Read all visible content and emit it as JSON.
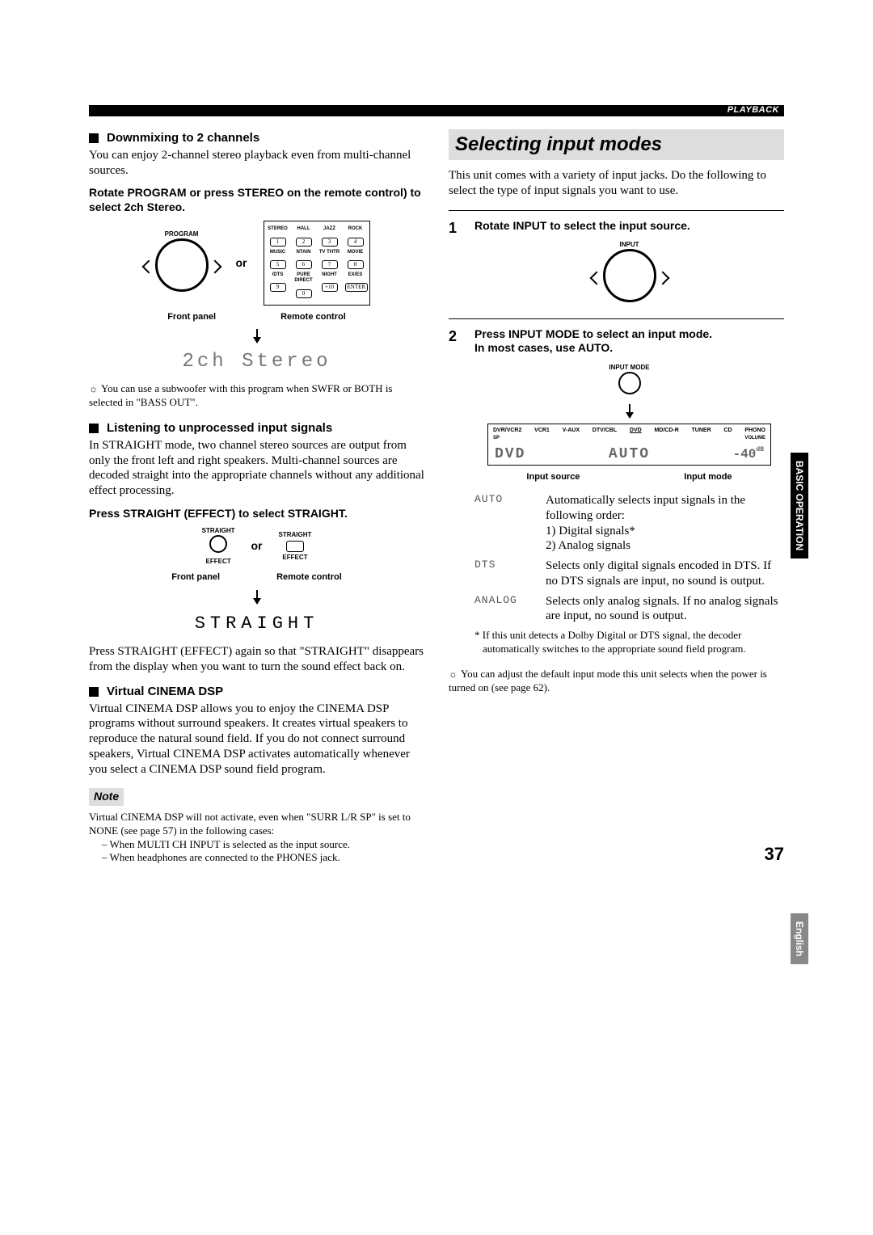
{
  "header": {
    "section": "PLAYBACK"
  },
  "left": {
    "h1": "Downmixing to 2 channels",
    "p1": "You can enjoy 2-channel stereo playback even from multi-channel sources.",
    "b1": "Rotate PROGRAM or press STEREO on the remote control) to select 2ch Stereo.",
    "diagram1": {
      "program": "PROGRAM",
      "or": "or",
      "front": "Front panel",
      "remote": "Remote control",
      "btns": [
        [
          "STEREO",
          "HALL",
          "JAZZ",
          "ROCK"
        ],
        [
          "1",
          "2",
          "3",
          "4"
        ],
        [
          "MUSIC",
          "NTAIN",
          "TV THTR",
          "MOVIE"
        ],
        [
          "5",
          "6",
          "7",
          "8"
        ],
        [
          "/DTS",
          "PURE DIRECT",
          "NIGHT",
          "EX/ES"
        ],
        [
          "9",
          "0",
          "+10",
          "ENTER"
        ]
      ]
    },
    "lcd1": "2ch Stereo",
    "tip1": "You can use a subwoofer with this program when SWFR or BOTH is selected in \"BASS OUT\".",
    "h2": "Listening to unprocessed input signals",
    "p2": "In STRAIGHT mode, two channel stereo sources are output from only the front left and right speakers. Multi-channel sources are decoded straight into the appropriate channels without any additional effect processing.",
    "b2": "Press STRAIGHT (EFFECT) to select STRAIGHT.",
    "diagram2": {
      "straight": "STRAIGHT",
      "effect": "EFFECT",
      "or": "or",
      "front": "Front panel",
      "remote": "Remote control"
    },
    "lcd2": "STRAIGHT",
    "p3": "Press STRAIGHT (EFFECT) again so that \"STRAIGHT\" disappears from the display when you want to turn the sound effect back on.",
    "h3": "Virtual CINEMA DSP",
    "p4": "Virtual CINEMA DSP allows you to enjoy the CINEMA DSP programs without surround speakers. It creates virtual speakers to reproduce the natural sound field. If you do not connect surround speakers, Virtual CINEMA DSP activates automatically whenever you select a CINEMA DSP sound field program.",
    "note": "Note",
    "p5": "Virtual CINEMA DSP will not activate, even when \"SURR L/R SP\" is set to NONE (see page 57) in the following cases:",
    "li1": "– When MULTI CH INPUT is selected as the input source.",
    "li2": "– When headphones are connected to the PHONES jack."
  },
  "right": {
    "title": "Selecting input modes",
    "p1": "This unit comes with a variety of input jacks. Do the following to select the type of input signals you want to use.",
    "s1": {
      "num": "1",
      "text": "Rotate INPUT to select the input source.",
      "label": "INPUT"
    },
    "s2": {
      "num": "2",
      "text1": "Press INPUT MODE to select an input mode.",
      "text2": "In most cases, use AUTO.",
      "btn_label": "INPUT MODE",
      "display": {
        "tops": [
          "DVR/VCR2",
          "VCR1",
          "V-AUX",
          "DTV/CBL",
          "DVD",
          "MD/CD-R",
          "TUNER",
          "CD",
          "PHONO"
        ],
        "sp": "SP",
        "vol_label": "VOLUME",
        "src": "DVD",
        "mode": "AUTO",
        "vol": "-40",
        "db": "dB"
      },
      "src_label": "Input source",
      "mode_label": "Input mode"
    },
    "modes": {
      "auto_k": "AUTO",
      "auto_v": "Automatically selects input signals in the following order:",
      "auto_1": "1) Digital signals*",
      "auto_2": "2) Analog signals",
      "dts_k": "DTS",
      "dts_v": "Selects only digital signals encoded in DTS. If no DTS signals are input, no sound is output.",
      "analog_k": "ANALOG",
      "analog_v": "Selects only analog signals. If no analog signals are input, no sound is output."
    },
    "foot": "* If this unit detects a Dolby Digital or DTS signal, the decoder automatically switches to the appropriate sound field program.",
    "tip": "You can adjust the default input mode this unit selects when the power is turned on (see page 62)."
  },
  "tabs": {
    "basic": "BASIC OPERATION",
    "lang": "English"
  },
  "page": "37"
}
